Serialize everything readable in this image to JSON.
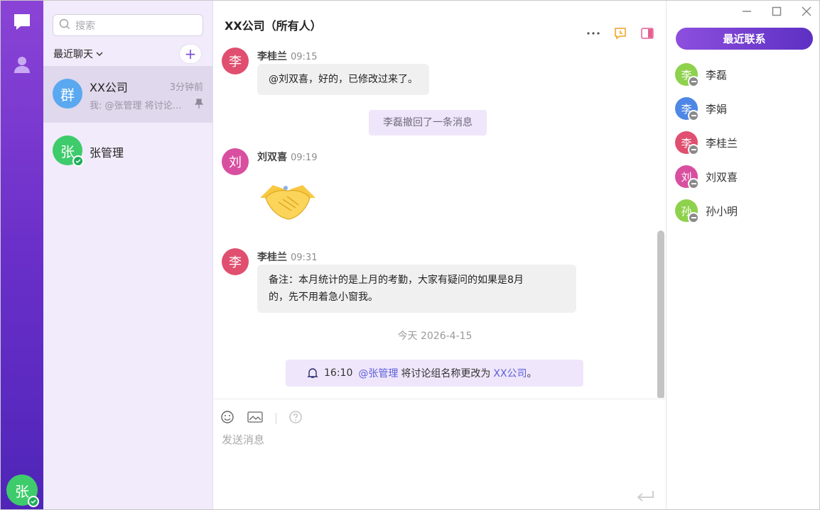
{
  "colors": {
    "accent": "#7b4fd6",
    "online": "#1cae5a",
    "group_avatar": "#5aa8f0",
    "green_avatar": "#3ecb6b",
    "red_avatar": "#e04f6f",
    "pink_avatar": "#d94fa0",
    "blue_avatar": "#4e87e6",
    "lime_avatar": "#8ed14c"
  },
  "rail": {
    "chat_icon": "chat-bubble-icon",
    "contacts_icon": "person-icon",
    "me_avatar": "张"
  },
  "sidebar": {
    "search_placeholder": "搜索",
    "section_title": "最近聊天",
    "conversations": [
      {
        "avatar": "群",
        "name": "XX公司",
        "time": "3分钟前",
        "preview": "我: @张管理 将讨论组名称更改为 XX公司。",
        "pinned": true
      },
      {
        "avatar": "张",
        "name": "张管理",
        "online": true
      }
    ]
  },
  "chat": {
    "title": "XX公司（所有人）",
    "messages": [
      {
        "sender": "李桂兰",
        "avatar": "李",
        "time": "09:15",
        "text": "@刘双喜，好的，已修改过来了。"
      },
      {
        "system": "李磊撤回了一条消息"
      },
      {
        "sender": "刘双喜",
        "avatar": "刘",
        "time": "09:19",
        "sticker": "handshake"
      },
      {
        "sender": "李桂兰",
        "avatar": "李",
        "time": "09:31",
        "text_line1": "备注：本月统计的是上月的考勤，大家有疑问的如果是8月",
        "text_line2": "的，先不用着急小窗我。"
      }
    ],
    "date_divider": "今天 2026-4-15",
    "notice": {
      "time": "16:10",
      "mention": "@张管理",
      "action": "将讨论组名称更改为",
      "target": "XX公司",
      "end": "。"
    },
    "composer_placeholder": "发送消息"
  },
  "right": {
    "recent_button": "最近联系",
    "contacts": [
      {
        "avatar": "李",
        "name": "李磊",
        "status": "busy"
      },
      {
        "avatar": "李",
        "name": "李娟",
        "status": "busy"
      },
      {
        "avatar": "李",
        "name": "李桂兰",
        "status": "busy"
      },
      {
        "avatar": "刘",
        "name": "刘双喜",
        "status": "busy"
      },
      {
        "avatar": "孙",
        "name": "孙小明",
        "status": "busy"
      }
    ]
  }
}
